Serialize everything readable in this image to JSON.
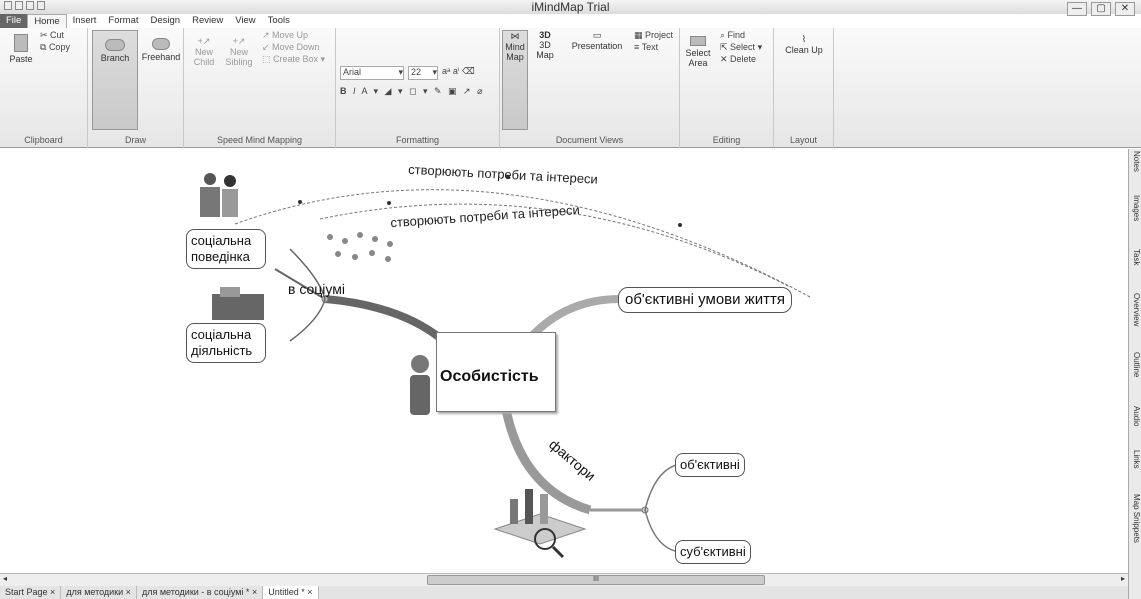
{
  "app": {
    "title": "iMindMap Trial",
    "window_controls": [
      "—",
      "▢",
      "✕"
    ]
  },
  "tabs": [
    "File",
    "Home",
    "Insert",
    "Format",
    "Design",
    "Review",
    "View",
    "Tools"
  ],
  "ribbon": {
    "clipboard": {
      "label": "Clipboard",
      "paste": "Paste",
      "cut": "Cut",
      "copy": "Copy"
    },
    "draw": {
      "label": "Draw",
      "branch": "Branch",
      "freehand": "Freehand"
    },
    "speed": {
      "label": "Speed Mind Mapping",
      "new_child": "New\nChild",
      "new_child_1": "New",
      "new_child_2": "Child",
      "new_sibling_1": "New",
      "new_sibling_2": "Sibling",
      "move_up": "Move Up",
      "move_down": "Move Down",
      "create_box": "Create Box"
    },
    "formatting": {
      "label": "Formatting",
      "font": "Arial",
      "size": "22"
    },
    "views": {
      "label": "Document Views",
      "mind_map_1": "Mind",
      "mind_map_2": "Map",
      "3d_1": "3D",
      "3d_2": "Map",
      "presentation": "Presentation",
      "project": "Project",
      "text": "Text"
    },
    "editing": {
      "label": "Editing",
      "select_area_1": "Select",
      "select_area_2": "Area",
      "find": "Find",
      "select": "Select",
      "delete": "Delete"
    },
    "layout": {
      "label": "Layout",
      "clean_up": "Clean Up"
    }
  },
  "mindmap": {
    "central": "Особистість",
    "branch_society": "в соціумі",
    "branch_factors": "фактори",
    "node_behavior_1": "соціальна",
    "node_behavior_2": "поведінка",
    "node_activity_1": "соціальна",
    "node_activity_2": "діяльність",
    "node_conditions": "об'єктивні умови життя",
    "node_objective": "об'єктивні",
    "node_subjective": "суб'єктивні",
    "relation_1": "створюють потреби та інтереси",
    "relation_2": "створюють потреби та інтереси"
  },
  "side_tabs": [
    "Notes",
    "Images",
    "Task",
    "Overview",
    "Outline",
    "Audio",
    "Links",
    "Map Snippets"
  ],
  "scroll_thumb": "III",
  "doc_tabs": [
    "Start Page",
    "для методики",
    "для методики - в соціумі *",
    "Untitled *"
  ]
}
